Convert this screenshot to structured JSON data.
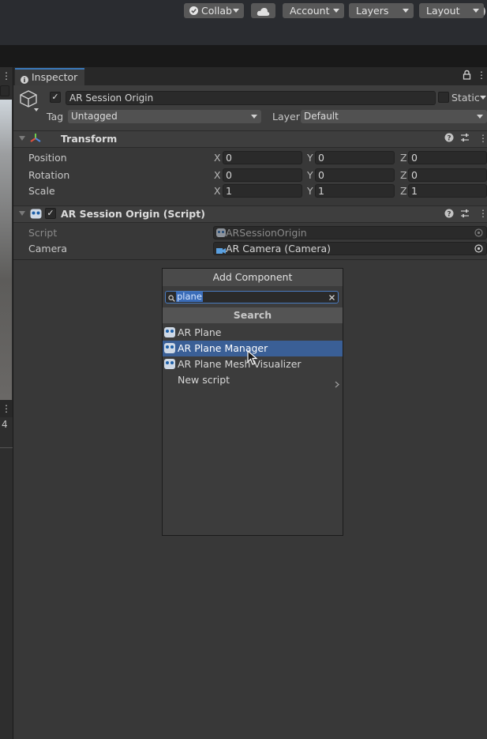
{
  "toolbar": {
    "collab": "Collab",
    "account": "Account",
    "layers": "Layers",
    "layout": "Layout"
  },
  "leftpanel": {
    "number": "4"
  },
  "inspector": {
    "tab_label": "Inspector",
    "object_name": "AR Session Origin",
    "static_label": "Static",
    "tag_label": "Tag",
    "tag_value": "Untagged",
    "layer_label": "Layer",
    "layer_value": "Default"
  },
  "transform": {
    "title": "Transform",
    "rows": [
      {
        "label": "Position",
        "x": "0",
        "y": "0",
        "z": "0"
      },
      {
        "label": "Rotation",
        "x": "0",
        "y": "0",
        "z": "0"
      },
      {
        "label": "Scale",
        "x": "1",
        "y": "1",
        "z": "1"
      }
    ],
    "axis": {
      "x": "X",
      "y": "Y",
      "z": "Z"
    }
  },
  "script_component": {
    "title": "AR Session Origin (Script)",
    "script_label": "Script",
    "script_value": "ARSessionOrigin",
    "camera_label": "Camera",
    "camera_value": "AR Camera (Camera)"
  },
  "add_component": {
    "title": "Add Component",
    "search_value": "plane",
    "category": "Search",
    "items": [
      {
        "label": "AR Plane",
        "selected": false
      },
      {
        "label": "AR Plane Manager",
        "selected": true
      },
      {
        "label": "AR Plane Mesh Visualizer",
        "selected": false
      }
    ],
    "new_script": "New script"
  },
  "colors": {
    "accent": "#3a5f96",
    "tab_highlight": "#3a79bb",
    "background": "#383838"
  }
}
